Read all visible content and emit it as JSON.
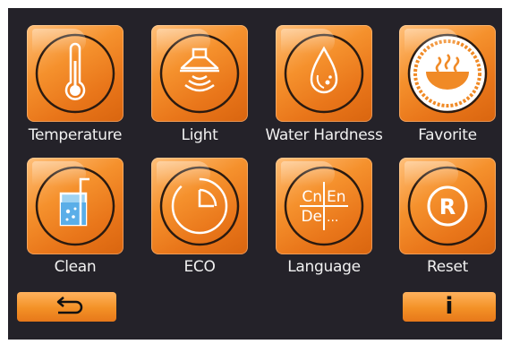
{
  "menu": {
    "items": [
      {
        "label": "Temperature",
        "icon": "thermometer-icon"
      },
      {
        "label": "Light",
        "icon": "hood-light-icon"
      },
      {
        "label": "Water Hardness",
        "icon": "water-drop-icon"
      },
      {
        "label": "Favorite",
        "icon": "bowl-icon"
      },
      {
        "label": "Clean",
        "icon": "glass-bubbles-icon"
      },
      {
        "label": "ECO",
        "icon": "clock-icon"
      },
      {
        "label": "Language",
        "icon": "language-icon"
      },
      {
        "label": "Reset",
        "icon": "registered-r-icon"
      }
    ]
  },
  "language_icon": {
    "tl": "Cn",
    "tr": "En",
    "bl": "De",
    "br": "..."
  },
  "reset_icon_letter": "R",
  "footer": {
    "back_icon": "return-arrow-icon",
    "info_label": "i"
  },
  "colors": {
    "screen_bg": "#242229",
    "tile_orange": "#f39126",
    "icon_white": "#ffffff",
    "label_text": "#f1f1f1"
  }
}
